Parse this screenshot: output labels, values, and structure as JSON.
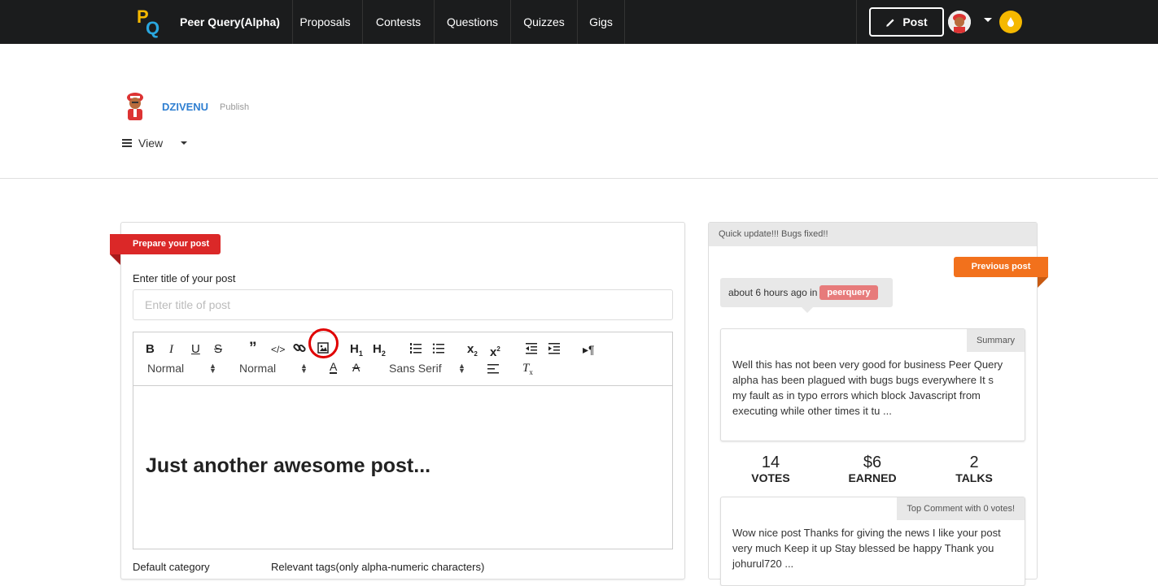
{
  "nav": {
    "logo_p": "P",
    "logo_q": "Q",
    "brand": "Peer Query(Alpha)",
    "items": [
      "Proposals",
      "Contests",
      "Questions",
      "Quizzes",
      "Gigs"
    ],
    "post_button": "Post"
  },
  "profile": {
    "username": "DZIVENU",
    "status": "Publish",
    "view_menu": "View"
  },
  "form": {
    "ribbon": "Prepare your post",
    "title_label": "Enter title of your post",
    "title_placeholder": "Enter title of post",
    "toolbar": {
      "header_select": "Normal",
      "size_select": "Normal",
      "font_select": "Sans Serif"
    },
    "editor_content": "Just another awesome post...",
    "category_label": "Default category",
    "tags_label": "Relevant tags(only alpha-numeric characters)"
  },
  "sidebar": {
    "header": "Quick update!!! Bugs fixed!!",
    "ribbon": "Previous post",
    "time": "about 6 hours ago in",
    "tag": "peerquery",
    "summary_label": "Summary",
    "summary_text": "Well this has not been very good for business Peer Query alpha has been plagued with bugs bugs everywhere It s my fault as in typo errors which block Javascript from executing while other times it tu ...",
    "stats": [
      {
        "value": "14",
        "label": "VOTES"
      },
      {
        "value": "$6",
        "label": "EARNED"
      },
      {
        "value": "2",
        "label": "TALKS"
      }
    ],
    "comment_label": "Top Comment with 0 votes!",
    "comment_text": "Wow nice post Thanks for giving the news I like your post very much Keep it up Stay blessed be happy Thank you johurul720 ..."
  },
  "colors": {
    "nav_bg": "#1b1c1d",
    "link_blue": "#2f7fd1",
    "ribbon_red": "#db2828",
    "ribbon_orange": "#f2711c",
    "coin_yellow": "#f5b800",
    "tag_pink": "#e77b7b"
  }
}
